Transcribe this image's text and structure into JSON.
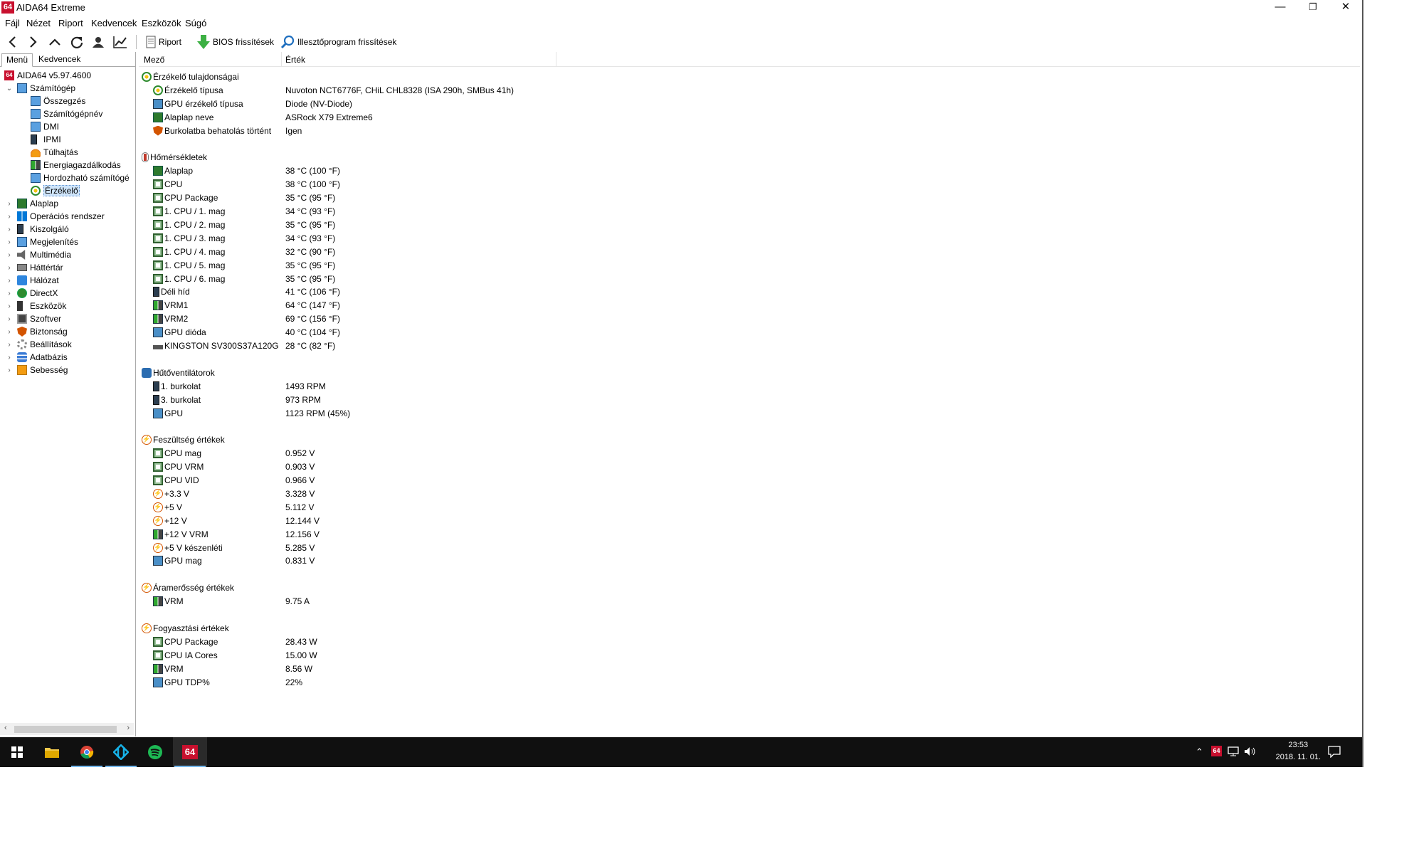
{
  "window": {
    "title": "AIDA64 Extreme",
    "logo_text": "64",
    "min": "—",
    "restore": "❐",
    "close": "✕"
  },
  "menu": [
    "Fájl",
    "Nézet",
    "Riport",
    "Kedvencek",
    "Eszközök",
    "Súgó"
  ],
  "toolbar": {
    "report_label": "Riport",
    "bios_label": "BIOS frissítések",
    "driver_label": "Illesztőprogram frissítések"
  },
  "tabs": {
    "menu": "Menü",
    "favorites": "Kedvencek"
  },
  "tree": {
    "root": "AIDA64 v5.97.4600",
    "computer": "Számítógép",
    "computer_children": [
      "Összegzés",
      "Számítógépnév",
      "DMI",
      "IPMI",
      "Túlhajtás",
      "Energiagazdálkodás",
      "Hordozható számítógé",
      "Érzékelő"
    ],
    "categories": [
      "Alaplap",
      "Operációs rendszer",
      "Kiszolgáló",
      "Megjelenítés",
      "Multimédia",
      "Háttértár",
      "Hálózat",
      "DirectX",
      "Eszközök",
      "Szoftver",
      "Biztonság",
      "Beállítások",
      "Adatbázis",
      "Sebesség"
    ]
  },
  "columns": {
    "field": "Mező",
    "value": "Érték"
  },
  "sections": [
    {
      "title": "Érzékelő tulajdonságai",
      "icon": "sensor-icon",
      "rows": [
        {
          "field": "Érzékelő típusa",
          "value": "Nuvoton NCT6776F, CHiL CHL8328  (ISA 290h, SMBus 41h)",
          "icon": "sensor-icon"
        },
        {
          "field": "GPU érzékelő típusa",
          "value": "Diode  (NV-Diode)",
          "icon": "gpu-icon"
        },
        {
          "field": "Alaplap neve",
          "value": "ASRock X79 Extreme6",
          "icon": "board-icon"
        },
        {
          "field": "Burkolatba behatolás történt",
          "value": "Igen",
          "icon": "shield-icon"
        }
      ]
    },
    {
      "title": "Hőmérsékletek",
      "icon": "thermometer-icon",
      "rows": [
        {
          "field": "Alaplap",
          "value": "38 °C  (100 °F)",
          "icon": "board-icon"
        },
        {
          "field": "CPU",
          "value": "38 °C  (100 °F)",
          "icon": "cpu-icon"
        },
        {
          "field": "CPU Package",
          "value": "35 °C  (95 °F)",
          "icon": "cpu-icon"
        },
        {
          "field": "1. CPU / 1. mag",
          "value": "34 °C  (93 °F)",
          "icon": "cpu-icon"
        },
        {
          "field": "1. CPU / 2. mag",
          "value": "35 °C  (95 °F)",
          "icon": "cpu-icon"
        },
        {
          "field": "1. CPU / 3. mag",
          "value": "34 °C  (93 °F)",
          "icon": "cpu-icon"
        },
        {
          "field": "1. CPU / 4. mag",
          "value": "32 °C  (90 °F)",
          "icon": "cpu-icon"
        },
        {
          "field": "1. CPU / 5. mag",
          "value": "35 °C  (95 °F)",
          "icon": "cpu-icon"
        },
        {
          "field": "1. CPU / 6. mag",
          "value": "35 °C  (95 °F)",
          "icon": "cpu-icon"
        },
        {
          "field": "Déli híd",
          "value": "41 °C  (106 °F)",
          "icon": "chipset-icon"
        },
        {
          "field": "VRM1",
          "value": "64 °C  (147 °F)",
          "icon": "vrm-icon"
        },
        {
          "field": "VRM2",
          "value": "69 °C  (156 °F)",
          "icon": "vrm-icon"
        },
        {
          "field": "GPU dióda",
          "value": "40 °C  (104 °F)",
          "icon": "gpu-icon"
        },
        {
          "field": "KINGSTON SV300S37A120G",
          "value": "28 °C  (82 °F)",
          "icon": "disk-icon"
        }
      ]
    },
    {
      "title": "Hűtőventilátorok",
      "icon": "fan-icon",
      "rows": [
        {
          "field": "1. burkolat",
          "value": "1493 RPM",
          "icon": "tower-icon"
        },
        {
          "field": "3. burkolat",
          "value": "973 RPM",
          "icon": "tower-icon"
        },
        {
          "field": "GPU",
          "value": "1123 RPM  (45%)",
          "icon": "gpu-icon"
        }
      ]
    },
    {
      "title": "Feszültség értékek",
      "icon": "voltage-icon",
      "rows": [
        {
          "field": "CPU mag",
          "value": "0.952 V",
          "icon": "cpu-icon"
        },
        {
          "field": "CPU VRM",
          "value": "0.903 V",
          "icon": "cpu-icon"
        },
        {
          "field": "CPU VID",
          "value": "0.966 V",
          "icon": "cpu-icon"
        },
        {
          "field": "+3.3 V",
          "value": "3.328 V",
          "icon": "voltage-icon"
        },
        {
          "field": "+5 V",
          "value": "5.112 V",
          "icon": "voltage-icon"
        },
        {
          "field": "+12 V",
          "value": "12.144 V",
          "icon": "voltage-icon"
        },
        {
          "field": "+12 V VRM",
          "value": "12.156 V",
          "icon": "vrm-icon"
        },
        {
          "field": "+5 V készenléti",
          "value": "5.285 V",
          "icon": "voltage-icon"
        },
        {
          "field": "GPU mag",
          "value": "0.831 V",
          "icon": "gpu-icon"
        }
      ]
    },
    {
      "title": "Áramerősség értékek",
      "icon": "voltage-icon",
      "rows": [
        {
          "field": "VRM",
          "value": "9.75 A",
          "icon": "vrm-icon"
        }
      ]
    },
    {
      "title": "Fogyasztási értékek",
      "icon": "voltage-icon",
      "rows": [
        {
          "field": "CPU Package",
          "value": "28.43 W",
          "icon": "cpu-icon"
        },
        {
          "field": "CPU IA Cores",
          "value": "15.00 W",
          "icon": "cpu-icon"
        },
        {
          "field": "VRM",
          "value": "8.56 W",
          "icon": "vrm-icon"
        },
        {
          "field": "GPU TDP%",
          "value": "22%",
          "icon": "gpu-icon"
        }
      ]
    }
  ],
  "taskbar": {
    "apps": [
      "start-icon",
      "file-explorer-icon",
      "chrome-icon",
      "kodi-icon",
      "spotify-icon",
      "aida64-icon"
    ],
    "time": "23:53",
    "date": "2018. 11. 01.",
    "aida_text": "64"
  }
}
